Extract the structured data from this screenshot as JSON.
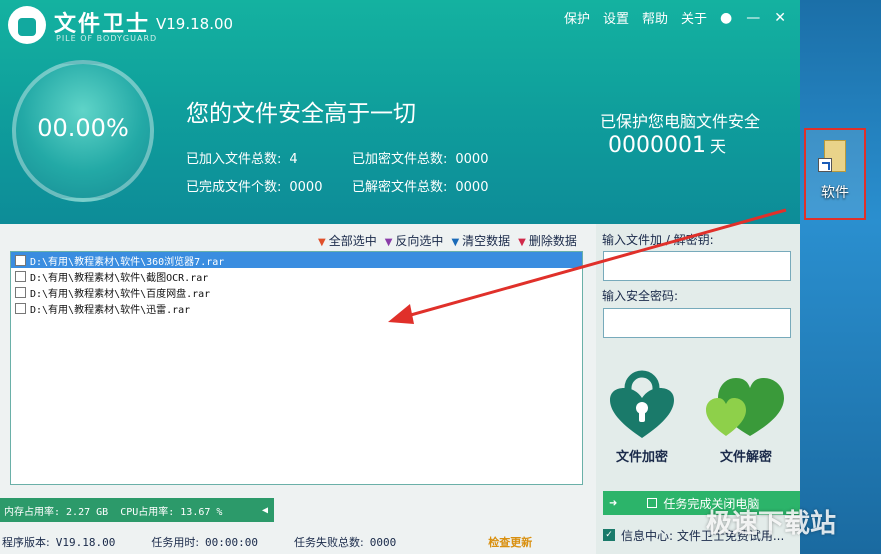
{
  "app": {
    "title": "文件卫士",
    "subtitle": "PILE OF BODYGUARD",
    "version": "V19.18.00"
  },
  "menu": [
    "保护",
    "设置",
    "帮助",
    "关于"
  ],
  "progress": {
    "percent_text": "00.00%"
  },
  "headline": "您的文件安全高于一切",
  "stats": {
    "added_label": "已加入文件总数:",
    "added_value": "4",
    "encrypted_label": "已加密文件总数:",
    "encrypted_value": "0000",
    "completed_label": "已完成文件个数:",
    "completed_value": "0000",
    "decrypted_label": "已解密文件总数:",
    "decrypted_value": "0000"
  },
  "protect": {
    "label": "已保护您电脑文件安全",
    "days": "0000001",
    "unit": "天"
  },
  "actions": [
    "全部选中",
    "反向选中",
    "清空数据",
    "删除数据"
  ],
  "files": [
    {
      "path": "D:\\有用\\教程素材\\软件\\360浏览器7.rar",
      "selected": true
    },
    {
      "path": "D:\\有用\\教程素材\\软件\\截图OCR.rar",
      "selected": false
    },
    {
      "path": "D:\\有用\\教程素材\\软件\\百度网盘.rar",
      "selected": false
    },
    {
      "path": "D:\\有用\\教程素材\\软件\\迅雷.rar",
      "selected": false
    }
  ],
  "right": {
    "key_label": "输入文件加 / 解密钥:",
    "password_label": "输入安全密码:",
    "encrypt_label": "文件加密",
    "decrypt_label": "文件解密",
    "shutdown_label": "任务完成关闭电脑",
    "info_label": "信息中心: 文件卫士免费试用..."
  },
  "status": {
    "mem": "内存占用率: 2.27 GB",
    "cpu": "CPU占用率: 13.67 %"
  },
  "footer": {
    "version_label": "程序版本:",
    "version_value": "V19.18.00",
    "time_label": "任务用时:",
    "time_value": "00:00:00",
    "fail_label": "任务失败总数:",
    "fail_value": "0000",
    "update_label": "检查更新"
  },
  "desktop": {
    "icon_label": "软件"
  },
  "watermark": "极速下载站",
  "colors": {
    "header": "#12a99f",
    "accent_green": "#2cb46a",
    "selected_row": "#3a8de0",
    "annotation": "#e0302a"
  }
}
